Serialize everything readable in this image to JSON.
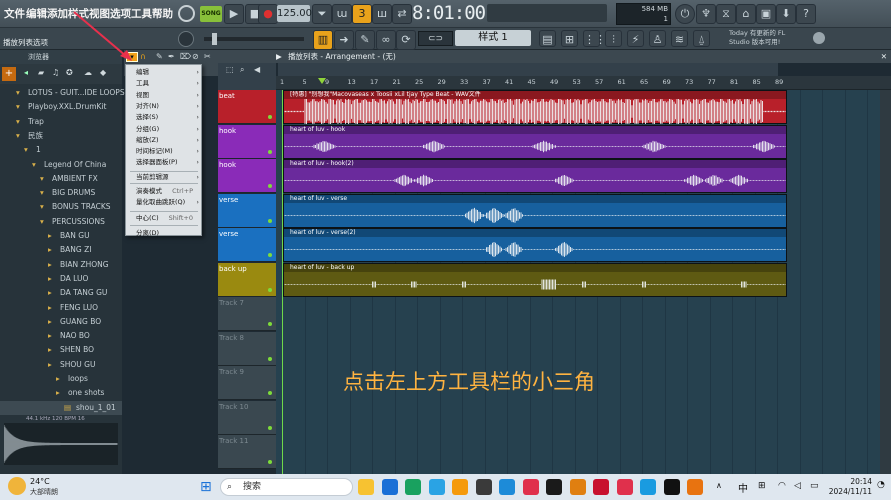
{
  "menu": {
    "items": [
      "文件",
      "编辑",
      "添加",
      "样式",
      "视图",
      "选项",
      "工具",
      "帮助"
    ]
  },
  "transport": {
    "song_label": "SONG",
    "tempo": "125.000",
    "time": "8:01:00",
    "cpu_mem": "584 MB",
    "cpu_num": "1"
  },
  "hint_label": "播放列表选项",
  "pattern": {
    "name": "样式 1"
  },
  "news": {
    "line1": "Today  有更新的 FL",
    "line2": "Studio 版本可用!"
  },
  "browser": {
    "title": "浏览器",
    "items": [
      {
        "label": "LOTUS - GUIT...IDE LOOPS(1)",
        "indent": 0
      },
      {
        "label": "Playboy.XXL.DrumKit",
        "indent": 0
      },
      {
        "label": "Trap",
        "indent": 0
      },
      {
        "label": "民族",
        "indent": 0
      },
      {
        "label": "1",
        "indent": 1
      },
      {
        "label": "Legend Of China",
        "indent": 2
      },
      {
        "label": "AMBIENT FX",
        "indent": 3
      },
      {
        "label": "BIG DRUMS",
        "indent": 3
      },
      {
        "label": "BONUS TRACKS",
        "indent": 3
      },
      {
        "label": "PERCUSSIONS",
        "indent": 3
      },
      {
        "label": "BAN GU",
        "indent": 4
      },
      {
        "label": "BANG ZI",
        "indent": 4
      },
      {
        "label": "BIAN ZHONG",
        "indent": 4
      },
      {
        "label": "DA LUO",
        "indent": 4
      },
      {
        "label": "DA TANG GU",
        "indent": 4
      },
      {
        "label": "FENG LUO",
        "indent": 4
      },
      {
        "label": "GUANG BO",
        "indent": 4
      },
      {
        "label": "NAO BO",
        "indent": 4
      },
      {
        "label": "SHEN BO",
        "indent": 4
      },
      {
        "label": "SHOU GU",
        "indent": 4
      },
      {
        "label": "loops",
        "indent": 5
      },
      {
        "label": "one shots",
        "indent": 5
      },
      {
        "label": "shou_1_01",
        "indent": 6
      }
    ],
    "wave_info": "44.1 kHz 120 BPM 16"
  },
  "playlist": {
    "title": "播放列表 - Arrangement - (无)",
    "ruler": [
      "1",
      "5",
      "9",
      "13",
      "17",
      "21",
      "25",
      "29",
      "33",
      "37",
      "41",
      "45",
      "49",
      "53",
      "57",
      "61",
      "65",
      "69",
      "73",
      "77",
      "81",
      "85",
      "89"
    ],
    "tracks": [
      {
        "name": "beat",
        "color": "#b8202a",
        "clip": "[特惠] \"别想我\"Macovaseas x Toosii xLil tjay Type Beat - WAV文件",
        "clipcolor": "#b8202a",
        "wave": "dense"
      },
      {
        "name": "hook",
        "color": "#8a2bb8",
        "clip": "heart of luv - hook",
        "clipcolor": "#6a2a9c",
        "wave": "sparse"
      },
      {
        "name": "hook",
        "color": "#8a2bb8",
        "clip": "heart of luv - hook(2)",
        "clipcolor": "#6a2a9c",
        "wave": "sparse2"
      },
      {
        "name": "verse",
        "color": "#1a70c0",
        "clip": "heart of luv - verse",
        "clipcolor": "#17609e",
        "wave": "mid"
      },
      {
        "name": "verse",
        "color": "#1a70c0",
        "clip": "heart of luv - verse(2)",
        "clipcolor": "#17609e",
        "wave": "mid2"
      },
      {
        "name": "back up",
        "color": "#9a8a10",
        "clip": "heart of luv - back up",
        "clipcolor": "#5e5a12",
        "wave": "dots"
      },
      {
        "name": "Track 7",
        "color": "",
        "clip": "",
        "clipcolor": "",
        "wave": ""
      },
      {
        "name": "Track 8",
        "color": "",
        "clip": "",
        "clipcolor": "",
        "wave": ""
      },
      {
        "name": "Track 9",
        "color": "",
        "clip": "",
        "clipcolor": "",
        "wave": ""
      },
      {
        "name": "Track 10",
        "color": "",
        "clip": "",
        "clipcolor": "",
        "wave": ""
      },
      {
        "name": "Track 11",
        "color": "",
        "clip": "",
        "clipcolor": "",
        "wave": ""
      }
    ]
  },
  "context_menu": {
    "items": [
      {
        "label": "编辑",
        "shortcut": "",
        "arrow": "›"
      },
      {
        "label": "工具",
        "shortcut": "",
        "arrow": "›"
      },
      {
        "label": "视图",
        "shortcut": "",
        "arrow": "›"
      },
      {
        "label": "对齐(N)",
        "shortcut": "",
        "arrow": "›"
      },
      {
        "label": "选择(S)",
        "shortcut": "",
        "arrow": "›"
      },
      {
        "label": "分组(G)",
        "shortcut": "",
        "arrow": "›"
      },
      {
        "label": "缩放(Z)",
        "shortcut": "",
        "arrow": "›"
      },
      {
        "label": "时间标记(M)",
        "shortcut": "",
        "arrow": "›"
      },
      {
        "label": "选择器面板(P)",
        "shortcut": "",
        "arrow": "›"
      },
      {
        "label": "当前剪辑源",
        "shortcut": "",
        "arrow": "›"
      },
      {
        "label": "演奏模式",
        "shortcut": "Ctrl+P",
        "arrow": ""
      },
      {
        "label": "量化取曲跳跃(Q)",
        "shortcut": "",
        "arrow": "›"
      },
      {
        "label": "中心(C)",
        "shortcut": "Shift+0",
        "arrow": ""
      },
      {
        "label": "分离(D)",
        "shortcut": "",
        "arrow": ""
      }
    ]
  },
  "caption": "点击左上方工具栏的小三角",
  "taskbar": {
    "weather_temp": "24°C",
    "weather_desc": "大部晴朗",
    "search": "搜索",
    "ime": "中",
    "time": "20:14",
    "date": "2024/11/11"
  }
}
